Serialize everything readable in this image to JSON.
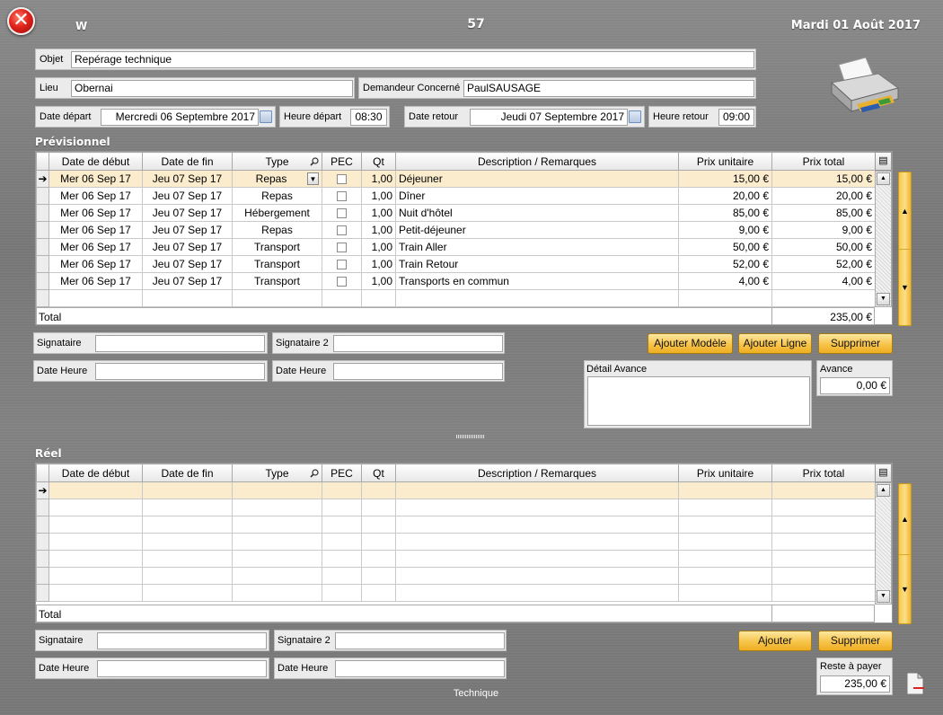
{
  "header": {
    "close_label": "✕",
    "w_label": "W",
    "record_number": "57",
    "date": "Mardi 01 Août 2017"
  },
  "form": {
    "objet_label": "Objet",
    "objet_value": "Repérage technique",
    "lieu_label": "Lieu",
    "lieu_value": "Obernai",
    "demandeur_label": "Demandeur Concerné",
    "demandeur_value": "PaulSAUSAGE",
    "date_depart_label": "Date départ",
    "date_depart_value": "Mercredi 06 Septembre 2017",
    "heure_depart_label": "Heure départ",
    "heure_depart_value": "08:30",
    "date_retour_label": "Date retour",
    "date_retour_value": "Jeudi 07 Septembre 2017",
    "heure_retour_label": "Heure retour",
    "heure_retour_value": "09:00"
  },
  "previsionnel": {
    "title": "Prévisionnel",
    "columns": [
      "Date de début",
      "Date de fin",
      "Type",
      "PEC",
      "Qt",
      "Description / Remarques",
      "Prix unitaire",
      "Prix total"
    ],
    "rows": [
      {
        "debut": "Mer 06 Sep 17",
        "fin": "Jeu 07 Sep 17",
        "type": "Repas",
        "qt": "1,00",
        "desc": "Déjeuner",
        "pu": "15,00 €",
        "pt": "15,00 €"
      },
      {
        "debut": "Mer 06 Sep 17",
        "fin": "Jeu 07 Sep 17",
        "type": "Repas",
        "qt": "1,00",
        "desc": "Dîner",
        "pu": "20,00 €",
        "pt": "20,00 €"
      },
      {
        "debut": "Mer 06 Sep 17",
        "fin": "Jeu 07 Sep 17",
        "type": "Hébergement",
        "qt": "1,00",
        "desc": "Nuit d'hôtel",
        "pu": "85,00 €",
        "pt": "85,00 €"
      },
      {
        "debut": "Mer 06 Sep 17",
        "fin": "Jeu 07 Sep 17",
        "type": "Repas",
        "qt": "1,00",
        "desc": "Petit-déjeuner",
        "pu": "9,00 €",
        "pt": "9,00 €"
      },
      {
        "debut": "Mer 06 Sep 17",
        "fin": "Jeu 07 Sep 17",
        "type": "Transport",
        "qt": "1,00",
        "desc": "Train Aller",
        "pu": "50,00 €",
        "pt": "50,00 €"
      },
      {
        "debut": "Mer 06 Sep 17",
        "fin": "Jeu 07 Sep 17",
        "type": "Transport",
        "qt": "1,00",
        "desc": "Train Retour",
        "pu": "52,00 €",
        "pt": "52,00 €"
      },
      {
        "debut": "Mer 06 Sep 17",
        "fin": "Jeu 07 Sep 17",
        "type": "Transport",
        "qt": "1,00",
        "desc": "Transports en commun",
        "pu": "4,00 €",
        "pt": "4,00 €"
      }
    ],
    "total_label": "Total",
    "total_value": "235,00 €",
    "signataire_label": "Signataire",
    "signataire2_label": "Signataire 2",
    "date_heure_label": "Date Heure",
    "date_heure2_label": "Date Heure",
    "btn_ajouter_modele": "Ajouter Modèle",
    "btn_ajouter_ligne": "Ajouter Ligne",
    "btn_supprimer": "Supprimer",
    "detail_avance_label": "Détail Avance",
    "avance_label": "Avance",
    "avance_value": "0,00 €"
  },
  "reel": {
    "title": "Réel",
    "total_label": "Total",
    "signataire_label": "Signataire",
    "signataire2_label": "Signataire 2",
    "date_heure_label": "Date Heure",
    "date_heure2_label": "Date Heure",
    "btn_ajouter": "Ajouter",
    "btn_supprimer": "Supprimer",
    "reste_label": "Reste à payer",
    "reste_value": "235,00 €"
  },
  "footer": {
    "technique_label": "Technique"
  },
  "icons": {
    "close": "close-icon",
    "printer": "printer-icon",
    "calendar": "calendar-icon",
    "magnifier": "magnifier-icon",
    "column_config": "column-config-icon",
    "document": "document-icon"
  }
}
